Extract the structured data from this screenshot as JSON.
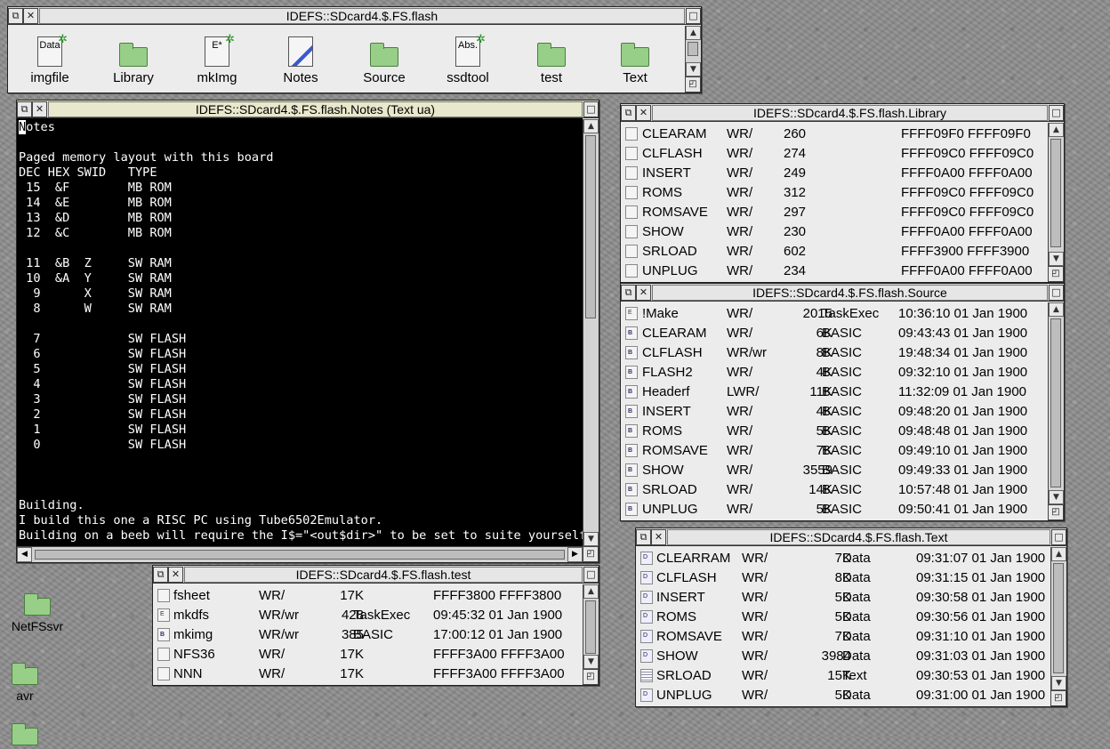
{
  "filer_main": {
    "title": "IDEFS::SDcard4.$.FS.flash",
    "items": [
      {
        "name": "imgfile",
        "icon": "data-file-icon",
        "badge": "Data"
      },
      {
        "name": "Library",
        "icon": "folder-icon"
      },
      {
        "name": "mkImg",
        "icon": "executable-file-icon",
        "badge": "E*"
      },
      {
        "name": "Notes",
        "icon": "notes-app-icon"
      },
      {
        "name": "Source",
        "icon": "folder-icon"
      },
      {
        "name": "ssdtool",
        "icon": "absolute-file-icon",
        "badge": "Abs."
      },
      {
        "name": "test",
        "icon": "folder-icon"
      },
      {
        "name": "Text",
        "icon": "folder-icon"
      }
    ]
  },
  "notes_window": {
    "title": "IDEFS::SDcard4.$.FS.flash.Notes (Text ua)",
    "cursor_char": "N",
    "first_line_rest": "otes",
    "lines": [
      "",
      "Paged memory layout with this board",
      "DEC HEX SWID   TYPE",
      " 15  &F        MB ROM",
      " 14  &E        MB ROM",
      " 13  &D        MB ROM",
      " 12  &C        MB ROM",
      "",
      " 11  &B  Z     SW RAM",
      " 10  &A  Y     SW RAM",
      "  9      X     SW RAM",
      "  8      W     SW RAM",
      "",
      "  7            SW FLASH",
      "  6            SW FLASH",
      "  5            SW FLASH",
      "  4            SW FLASH",
      "  3            SW FLASH",
      "  2            SW FLASH",
      "  1            SW FLASH",
      "  0            SW FLASH",
      "",
      "",
      "",
      "Building.",
      "I build this one a RISC PC using Tube6502Emulator.",
      "Building on a beeb will require the I$=\"<out$dir>\" to be set to suite yourself."
    ]
  },
  "library_window": {
    "title": "IDEFS::SDcard4.$.FS.flash.Library",
    "rows": [
      {
        "name": "CLEARAM",
        "access": "WR/",
        "size": "260",
        "addr": "FFFF09F0 FFFF09F0"
      },
      {
        "name": "CLFLASH",
        "access": "WR/",
        "size": "274",
        "addr": "FFFF09C0 FFFF09C0"
      },
      {
        "name": "INSERT",
        "access": "WR/",
        "size": "249",
        "addr": "FFFF0A00 FFFF0A00"
      },
      {
        "name": "ROMS",
        "access": "WR/",
        "size": "312",
        "addr": "FFFF09C0 FFFF09C0"
      },
      {
        "name": "ROMSAVE",
        "access": "WR/",
        "size": "297",
        "addr": "FFFF09C0 FFFF09C0"
      },
      {
        "name": "SHOW",
        "access": "WR/",
        "size": "230",
        "addr": "FFFF0A00 FFFF0A00"
      },
      {
        "name": "SRLOAD",
        "access": "WR/",
        "size": "602",
        "addr": "FFFF3900 FFFF3900"
      },
      {
        "name": "UNPLUG",
        "access": "WR/",
        "size": "234",
        "addr": "FFFF0A00 FFFF0A00"
      }
    ]
  },
  "source_window": {
    "title": "IDEFS::SDcard4.$.FS.flash.Source",
    "rows": [
      {
        "name": "!Make",
        "access": "WR/",
        "size": "2015",
        "type": "TaskExec",
        "date": "10:36:10 01 Jan 1900",
        "icon": "task"
      },
      {
        "name": "CLEARAM",
        "access": "WR/",
        "size": "6K",
        "type": "BASIC",
        "date": "09:43:43 01 Jan 1900",
        "icon": "basic"
      },
      {
        "name": "CLFLASH",
        "access": "WR/wr",
        "size": "8K",
        "type": "BASIC",
        "date": "19:48:34 01 Jan 1900",
        "icon": "basic"
      },
      {
        "name": "FLASH2",
        "access": "WR/",
        "size": "4K",
        "type": "BASIC",
        "date": "09:32:10 01 Jan 1900",
        "icon": "basic"
      },
      {
        "name": "Headerf",
        "access": "LWR/",
        "size": "11K",
        "type": "BASIC",
        "date": "11:32:09 01 Jan 1900",
        "icon": "basic"
      },
      {
        "name": "INSERT",
        "access": "WR/",
        "size": "4K",
        "type": "BASIC",
        "date": "09:48:20 01 Jan 1900",
        "icon": "basic"
      },
      {
        "name": "ROMS",
        "access": "WR/",
        "size": "5K",
        "type": "BASIC",
        "date": "09:48:48 01 Jan 1900",
        "icon": "basic"
      },
      {
        "name": "ROMSAVE",
        "access": "WR/",
        "size": "7K",
        "type": "BASIC",
        "date": "09:49:10 01 Jan 1900",
        "icon": "basic"
      },
      {
        "name": "SHOW",
        "access": "WR/",
        "size": "3559",
        "type": "BASIC",
        "date": "09:49:33 01 Jan 1900",
        "icon": "basic"
      },
      {
        "name": "SRLOAD",
        "access": "WR/",
        "size": "14K",
        "type": "BASIC",
        "date": "10:57:48 01 Jan 1900",
        "icon": "basic"
      },
      {
        "name": "UNPLUG",
        "access": "WR/",
        "size": "5K",
        "type": "BASIC",
        "date": "09:50:41 01 Jan 1900",
        "icon": "basic"
      }
    ]
  },
  "test_window": {
    "title": "IDEFS::SDcard4.$.FS.flash.test",
    "rows": [
      {
        "name": "fsheet",
        "access": "WR/",
        "size": "17K",
        "type": "",
        "date": "FFFF3800 FFFF3800",
        "icon": "plain"
      },
      {
        "name": "mkdfs",
        "access": "WR/wr",
        "size": "428",
        "type": "TaskExec",
        "date": "09:45:32 01 Jan 1900",
        "icon": "task"
      },
      {
        "name": "mkimg",
        "access": "WR/wr",
        "size": "385",
        "type": "BASIC",
        "date": "17:00:12 01 Jan 1900",
        "icon": "basic"
      },
      {
        "name": "NFS36",
        "access": "WR/",
        "size": "17K",
        "type": "",
        "date": "FFFF3A00 FFFF3A00",
        "icon": "plain"
      },
      {
        "name": "NNN",
        "access": "WR/",
        "size": "17K",
        "type": "",
        "date": "FFFF3A00 FFFF3A00",
        "icon": "plain"
      }
    ]
  },
  "text_window": {
    "title": "IDEFS::SDcard4.$.FS.flash.Text",
    "rows": [
      {
        "name": "CLEARRAM",
        "access": "WR/",
        "size": "7K",
        "type": "Data",
        "date": "09:31:07 01 Jan 1900",
        "icon": "data"
      },
      {
        "name": "CLFLASH",
        "access": "WR/",
        "size": "8K",
        "type": "Data",
        "date": "09:31:15 01 Jan 1900",
        "icon": "data"
      },
      {
        "name": "INSERT",
        "access": "WR/",
        "size": "5K",
        "type": "Data",
        "date": "09:30:58 01 Jan 1900",
        "icon": "data"
      },
      {
        "name": "ROMS",
        "access": "WR/",
        "size": "5K",
        "type": "Data",
        "date": "09:30:56 01 Jan 1900",
        "icon": "data"
      },
      {
        "name": "ROMSAVE",
        "access": "WR/",
        "size": "7K",
        "type": "Data",
        "date": "09:31:10 01 Jan 1900",
        "icon": "data"
      },
      {
        "name": "SHOW",
        "access": "WR/",
        "size": "3984",
        "type": "Data",
        "date": "09:31:03 01 Jan 1900",
        "icon": "data"
      },
      {
        "name": "SRLOAD",
        "access": "WR/",
        "size": "15K",
        "type": "Text",
        "date": "09:30:53 01 Jan 1900",
        "icon": "text"
      },
      {
        "name": "UNPLUG",
        "access": "WR/",
        "size": "5K",
        "type": "Data",
        "date": "09:31:00 01 Jan 1900",
        "icon": "data"
      }
    ]
  },
  "desktop": {
    "icons": [
      {
        "label": "NetFSsvr",
        "icon": "folder-icon"
      },
      {
        "label": "avr",
        "icon": "folder-icon"
      }
    ]
  },
  "colors": {
    "folder": "#98cf88",
    "window_bg": "#ececec",
    "desktop": "#8e8e8e"
  }
}
